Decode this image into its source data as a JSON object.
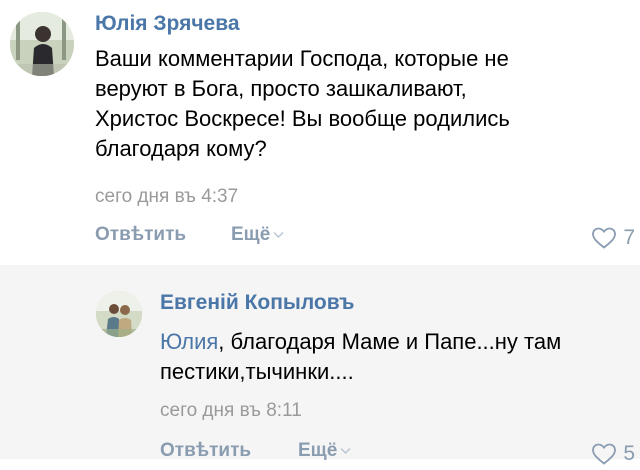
{
  "comments": [
    {
      "author": "Юлія Зрячева",
      "text_lines": [
        "Ваши комментарии Господа, которые не",
        "веруют в Бога, просто зашкаливают,",
        "Христос Воскресе! Вы вообще родились",
        "благодаря кому?"
      ],
      "date": "сего дня въ 4:37",
      "reply_label": "Отвѣтить",
      "more_label": "Ещё",
      "likes": "7"
    },
    {
      "author": "Евгеній Копыловъ",
      "mention": "Юлия",
      "text_line1_rest": ", благодаря Маме и Папе...ну там",
      "text_line2": "пестики,тычинки....",
      "date": "сего дня въ 8:11",
      "reply_label": "Отвѣтить",
      "more_label": "Ещё",
      "likes": "5"
    }
  ],
  "colors": {
    "author": "#4a76a8",
    "meta": "#9a9a9a",
    "action": "#8a9cb0",
    "reply_bg": "#f5f5f5"
  },
  "icons": [
    "avatar",
    "chevron-down-icon",
    "heart-icon"
  ]
}
